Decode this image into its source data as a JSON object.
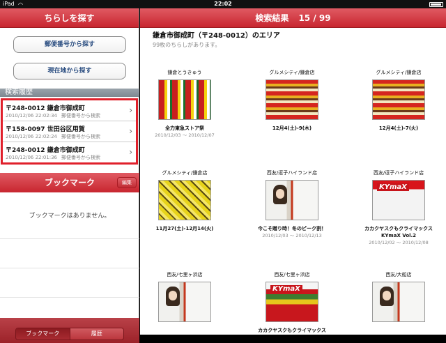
{
  "statusbar": {
    "carrier": "iPad",
    "time": "22:02"
  },
  "left": {
    "title": "ちらしを探す",
    "search_postcode": "郵便番号から探す",
    "search_location": "現在地から探す",
    "history_header": "検索履歴",
    "history": [
      {
        "title": "〒248-0012 鎌倉市御成町",
        "time": "2010/12/06 22:02:34",
        "method": "郵便番号から検索"
      },
      {
        "title": "〒158-0097 世田谷区用賀",
        "time": "2010/12/06 22:02:24",
        "method": "郵便番号から検索"
      },
      {
        "title": "〒248-0012 鎌倉市御成町",
        "time": "2010/12/06 22:01:36",
        "method": "郵便番号から検索"
      }
    ],
    "bookmark_title": "ブックマーク",
    "edit": "編集",
    "bookmark_empty": "ブックマークはありません。",
    "tabs": {
      "bookmark": "ブックマーク",
      "history": "履歴"
    }
  },
  "right": {
    "title": "検索結果",
    "count": "15 / 99",
    "area": "鎌倉市御成町（〒248-0012）のエリア",
    "subtitle": "99枚のちらしがあります。",
    "cards": [
      {
        "store": "鎌倉とうきゅう",
        "cap": "全力東急ストア祭",
        "date": "2010/12/03 〜 2010/12/07",
        "thumb": "th-red"
      },
      {
        "store": "グルメシティ/鎌倉店",
        "cap": "12月4(土)-9(木)",
        "date": "",
        "thumb": "th-mix"
      },
      {
        "store": "グルメシティ/鎌倉店",
        "cap": "12月4(土)-7(火)",
        "date": "",
        "thumb": "th-mix"
      },
      {
        "store": "グルメシティ/鎌倉店",
        "cap": "11月27(土)-12月14(火)",
        "date": "",
        "thumb": "th-yel"
      },
      {
        "store": "西友/逗子ハイランド店",
        "cap": "今こそ贈り時！冬のピーク割！",
        "date": "2010/12/03 〜 2010/12/13",
        "thumb": "th-girl"
      },
      {
        "store": "西友/逗子ハイランド店",
        "cap": "カカクヤスクもクライマックス KYmaX Vol.2",
        "date": "2010/12/02 〜 2010/12/08",
        "thumb": "th-kym"
      },
      {
        "store": "西友/七里ヶ浜店",
        "cap": "",
        "date": "",
        "thumb": "th-girl"
      },
      {
        "store": "西友/七里ヶ浜店",
        "cap": "カカクヤスクもクライマックス",
        "date": "",
        "thumb": "th-kym2"
      },
      {
        "store": "西友/大船店",
        "cap": "",
        "date": "",
        "thumb": "th-girl"
      }
    ]
  }
}
